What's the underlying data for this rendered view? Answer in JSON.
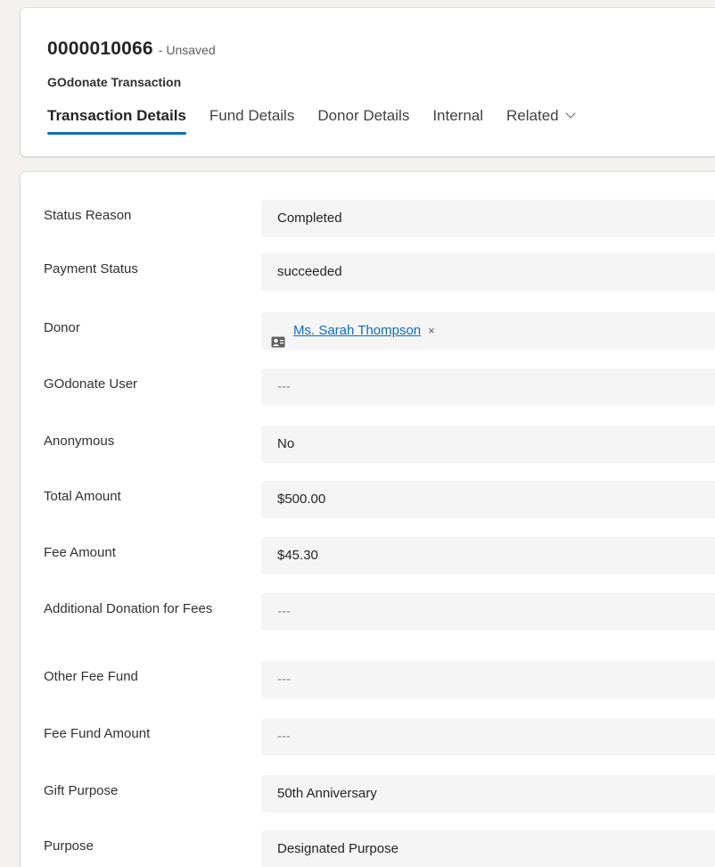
{
  "header": {
    "record_id": "0000010066",
    "unsaved_label": "- Unsaved",
    "entity_name": "GOdonate Transaction",
    "tabs": [
      {
        "label": "Transaction Details"
      },
      {
        "label": "Fund Details"
      },
      {
        "label": "Donor Details"
      },
      {
        "label": "Internal"
      },
      {
        "label": "Related"
      }
    ]
  },
  "fields": [
    {
      "label": "Status Reason",
      "value": "Completed"
    },
    {
      "label": "Payment Status",
      "value": "succeeded"
    },
    {
      "label": "Donor",
      "value": "Ms. Sarah Thompson",
      "remove_glyph": "×"
    },
    {
      "label": "GOdonate User",
      "value": "---"
    },
    {
      "label": "Anonymous",
      "value": "No"
    },
    {
      "label": "Total Amount",
      "value": "$500.00"
    },
    {
      "label": "Fee Amount",
      "value": "$45.30"
    },
    {
      "label": "Additional Donation for Fees",
      "value": "---"
    },
    {
      "label": "Other Fee Fund",
      "value": "---"
    },
    {
      "label": "Fee Fund Amount",
      "value": "---"
    },
    {
      "label": "Gift Purpose",
      "value": "50th Anniversary"
    },
    {
      "label": "Purpose",
      "value": "Designated Purpose"
    }
  ],
  "icons": {
    "donor_lookup": "contact-card-icon",
    "related_dropdown": "chevron-down-icon",
    "remove": "close-icon"
  },
  "colors": {
    "accent": "#0f6cbd",
    "field_background": "#f5f5f5",
    "page_background": "#f3f2f1"
  }
}
